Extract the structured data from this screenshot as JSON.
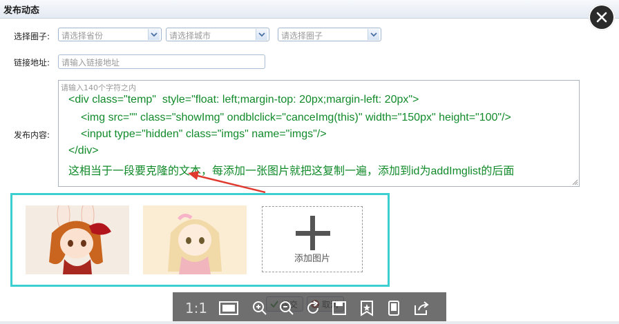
{
  "dialog": {
    "title": "发布动态"
  },
  "form": {
    "circle_label": "选择圈子:",
    "province_placeholder": "请选择省份",
    "city_placeholder": "请选择城市",
    "circle_placeholder": "请选择圈子",
    "link_label": "链接地址:",
    "link_placeholder": "请输入链接地址",
    "content_label": "发布内容:",
    "content_placeholder": "请输入140个字符之内"
  },
  "content_lines": [
    "<div class=\"temp\"  style=\"float: left;margin-top: 20px;margin-left: 20px\">",
    "<img src=\"\" class=\"showImg\" ondblclick=\"canceImg(this)\" width=\"150px\" height=\"100\"/>",
    "<input type=\"hidden\" class=\"imgs\" name=\"imgs\"/>",
    "</div>",
    "这相当于一段要克隆的文本，每添加一张图片就把这复制一遍，添加到id为addImglist的后面"
  ],
  "images": {
    "add_label": "添加图片"
  },
  "actions": {
    "submit_label": "提交",
    "cancel_label": "取消"
  },
  "viewer": {
    "ratio_label": "1:1"
  },
  "colors": {
    "highlight_border": "#3ccfcf",
    "code_text": "#118a2a",
    "arrow": "#e03a2e"
  }
}
